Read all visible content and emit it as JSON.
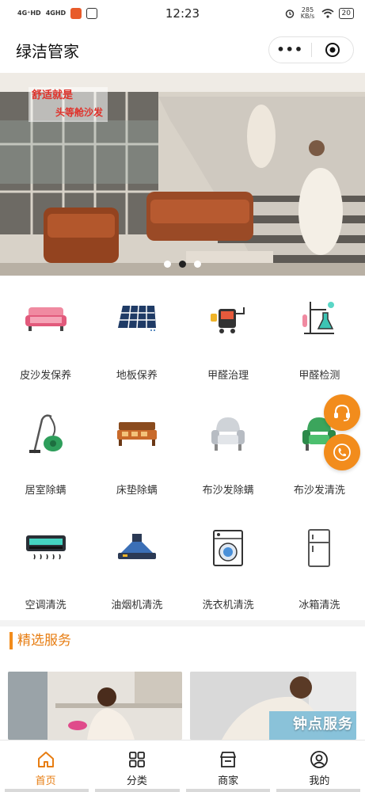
{
  "status_bar": {
    "signal_1": "4G⁺HD",
    "signal_2": "4GHD",
    "time": "12:23",
    "net_speed": "285 KB/s",
    "battery": "20"
  },
  "header": {
    "title": "绿洁管家",
    "more_label": "•••"
  },
  "banner": {
    "ad_text_1": "舒适就是",
    "ad_text_2": "头等舱沙发",
    "slide_count": 3,
    "active_slide": 1
  },
  "categories": [
    {
      "label": "皮沙发保养",
      "icon": "sofa-pink-icon"
    },
    {
      "label": "地板保养",
      "icon": "floor-tiles-icon"
    },
    {
      "label": "甲醛治理",
      "icon": "formaldehyde-machine-icon"
    },
    {
      "label": "甲醛检测",
      "icon": "lab-flask-icon"
    },
    {
      "label": "居室除螨",
      "icon": "vacuum-cleaner-icon"
    },
    {
      "label": "床垫除螨",
      "icon": "bed-icon"
    },
    {
      "label": "布沙发除螨",
      "icon": "armchair-gray-icon"
    },
    {
      "label": "布沙发清洗",
      "icon": "armchair-green-icon"
    },
    {
      "label": "空调清洗",
      "icon": "air-conditioner-icon"
    },
    {
      "label": "油烟机清洗",
      "icon": "range-hood-icon"
    },
    {
      "label": "洗衣机清洗",
      "icon": "washing-machine-icon"
    },
    {
      "label": "冰箱清洗",
      "icon": "refrigerator-icon"
    }
  ],
  "featured": {
    "title": "精选服务",
    "card_2_badge": "钟点服务"
  },
  "tabs": [
    {
      "label": "首页",
      "icon": "home-icon",
      "active": true
    },
    {
      "label": "分类",
      "icon": "grid-icon",
      "active": false
    },
    {
      "label": "商家",
      "icon": "store-icon",
      "active": false
    },
    {
      "label": "我的",
      "icon": "user-icon",
      "active": false
    }
  ],
  "colors": {
    "accent": "#f28c1c",
    "accent_text": "#e77d12"
  }
}
